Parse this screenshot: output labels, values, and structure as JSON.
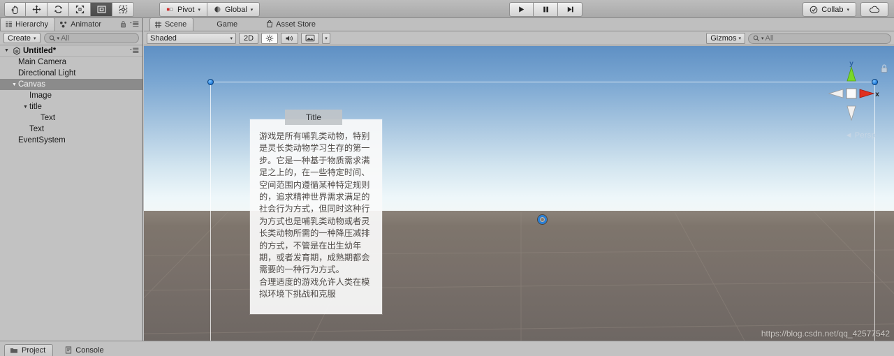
{
  "toolbar": {
    "tools": [
      {
        "name": "hand-tool",
        "icon": "hand-icon",
        "active": false
      },
      {
        "name": "move-tool",
        "icon": "move-icon",
        "active": false
      },
      {
        "name": "rotate-tool",
        "icon": "rotate-icon",
        "active": false
      },
      {
        "name": "scale-tool",
        "icon": "scale-icon",
        "active": false
      },
      {
        "name": "rect-tool",
        "icon": "rect-icon",
        "active": true
      },
      {
        "name": "transform-tool",
        "icon": "transform-icon",
        "active": false
      }
    ],
    "pivot_label": "Pivot",
    "global_label": "Global",
    "play_label": "Play",
    "pause_label": "Pause",
    "step_label": "Step",
    "collab_label": "Collab",
    "cloud_label": "Cloud"
  },
  "hierarchy": {
    "tabs": [
      {
        "label": "Hierarchy",
        "icon": "hierarchy-icon",
        "selected": true
      },
      {
        "label": "Animator",
        "icon": "animator-icon",
        "selected": false
      }
    ],
    "create_label": "Create",
    "search_placeholder": "All",
    "scene_name": "Untitled*",
    "items": [
      {
        "label": "Main Camera",
        "depth": 1,
        "expandable": false,
        "selected": false
      },
      {
        "label": "Directional Light",
        "depth": 1,
        "expandable": false,
        "selected": false
      },
      {
        "label": "Canvas",
        "depth": 1,
        "expandable": true,
        "selected": true
      },
      {
        "label": "Image",
        "depth": 2,
        "expandable": false,
        "selected": false
      },
      {
        "label": "title",
        "depth": 2,
        "expandable": true,
        "selected": false
      },
      {
        "label": "Text",
        "depth": 3,
        "expandable": false,
        "selected": false
      },
      {
        "label": "Text",
        "depth": 2,
        "expandable": false,
        "selected": false
      },
      {
        "label": "EventSystem",
        "depth": 1,
        "expandable": false,
        "selected": false
      }
    ]
  },
  "scene": {
    "tabs": [
      {
        "label": "Scene",
        "icon": "scene-icon",
        "selected": true
      },
      {
        "label": "Game",
        "icon": "game-icon",
        "selected": false
      },
      {
        "label": "Asset Store",
        "icon": "store-icon",
        "selected": false
      }
    ],
    "shading_mode": "Shaded",
    "mode_2d": "2D",
    "lighting_icon": "sun-icon",
    "audio_icon": "speaker-icon",
    "fx_icon": "image-icon",
    "gizmos_label": "Gizmos",
    "gizmo_search_placeholder": "All",
    "projection_label": "Persp",
    "axis_x": "x",
    "axis_y": "y",
    "ui_title": "Title",
    "ui_body": "游戏是所有哺乳类动物，特别是灵长类动物学习生存的第一步。它是一种基于物质需求满足之上的，在一些特定时间、空间范围内遵循某种特定规则的，追求精神世界需求满足的社会行为方式，但同时这种行为方式也是哺乳类动物或者灵长类动物所需的一种降压减排的方式，不管是在出生幼年期，或者发育期，成熟期都会需要的一种行为方式。\n合理适度的游戏允许人类在模拟环境下挑战和克服",
    "watermark": "https://blog.csdn.net/qq_42577542"
  },
  "bottom": {
    "tabs": [
      {
        "label": "Project",
        "icon": "folder-icon",
        "selected": true
      },
      {
        "label": "Console",
        "icon": "console-icon",
        "selected": false
      }
    ]
  },
  "colors": {
    "chrome": "#c2c2c2",
    "selection": "#8b8b8b",
    "handle_blue": "#1b78d8",
    "axis_x_red": "#e03020",
    "axis_y_green": "#7ad82a"
  }
}
